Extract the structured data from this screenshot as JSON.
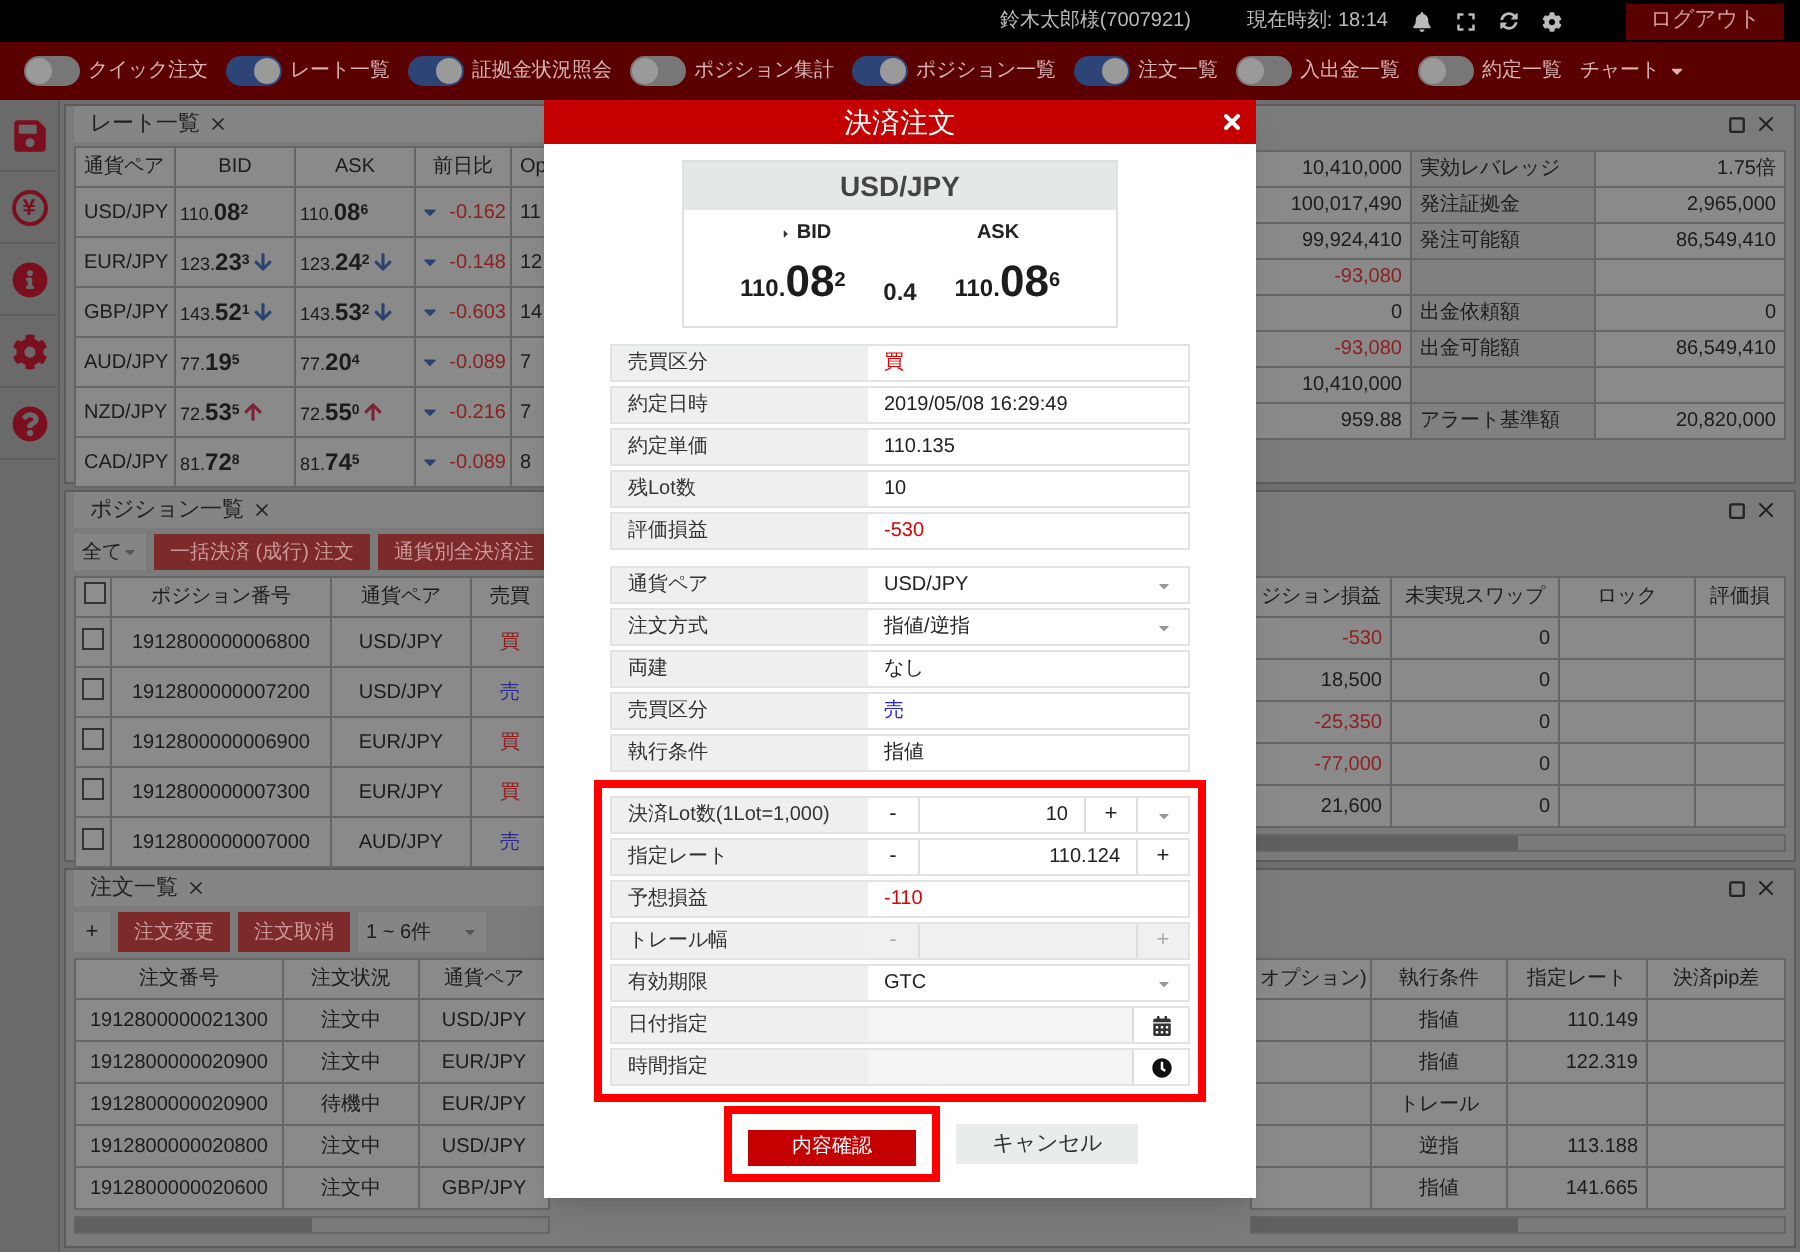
{
  "top_bar": {
    "user": "鈴木太郎様(7007921)",
    "clock": "現在時刻: 18:14",
    "logout": "ログアウト"
  },
  "toolbar": {
    "toggles": [
      {
        "label": "クイック注文",
        "on": false
      },
      {
        "label": "レート一覧",
        "on": true
      },
      {
        "label": "証拠金状況照会",
        "on": true
      },
      {
        "label": "ポジション集計",
        "on": false
      },
      {
        "label": "ポジション一覧",
        "on": true
      },
      {
        "label": "注文一覧",
        "on": true
      },
      {
        "label": "入出金一覧",
        "on": false
      },
      {
        "label": "約定一覧",
        "on": false
      }
    ],
    "menu": "チャート"
  },
  "sidebar": {
    "items": [
      {
        "kind": "save"
      },
      {
        "kind": "yen"
      },
      {
        "kind": "info"
      },
      {
        "kind": "settings"
      },
      {
        "kind": "help"
      }
    ]
  },
  "rate_panel": {
    "tab": "レート一覧",
    "columns": [
      "通貨ペア",
      "BID",
      "ASK",
      "前日比",
      "Op"
    ],
    "rows": [
      {
        "pair": "USD/JPY",
        "bid": {
          "base": "110.",
          "big": "08",
          "pip": "2",
          "falling": false,
          "rising": false
        },
        "ask": {
          "base": "110.",
          "big": "08",
          "pip": "6",
          "falling": false,
          "rising": false
        },
        "change": "-0.162",
        "change_falling": true,
        "column_5": "11"
      },
      {
        "pair": "EUR/JPY",
        "bid": {
          "base": "123.",
          "big": "23",
          "pip": "3",
          "falling": true,
          "rising": false
        },
        "ask": {
          "base": "123.",
          "big": "24",
          "pip": "2",
          "falling": true,
          "rising": false
        },
        "change": "-0.148",
        "change_falling": true,
        "column_5": "12"
      },
      {
        "pair": "GBP/JPY",
        "bid": {
          "base": "143.",
          "big": "52",
          "pip": "1",
          "falling": true,
          "rising": false
        },
        "ask": {
          "base": "143.",
          "big": "53",
          "pip": "2",
          "falling": true,
          "rising": false
        },
        "change": "-0.603",
        "change_falling": true,
        "column_5": "14"
      },
      {
        "pair": "AUD/JPY",
        "bid": {
          "base": "77.",
          "big": "19",
          "pip": "5",
          "falling": false,
          "rising": false
        },
        "ask": {
          "base": "77.",
          "big": "20",
          "pip": "4",
          "falling": false,
          "rising": false
        },
        "change": "-0.089",
        "change_falling": true,
        "column_5": "7"
      },
      {
        "pair": "NZD/JPY",
        "bid": {
          "base": "72.",
          "big": "53",
          "pip": "5",
          "falling": false,
          "rising": true
        },
        "ask": {
          "base": "72.",
          "big": "55",
          "pip": "0",
          "falling": false,
          "rising": true
        },
        "change": "-0.216",
        "change_falling": true,
        "column_5": "7"
      },
      {
        "pair": "CAD/JPY",
        "bid": {
          "base": "81.",
          "big": "72",
          "pip": "8",
          "falling": false,
          "rising": false
        },
        "ask": {
          "base": "81.",
          "big": "74",
          "pip": "5",
          "falling": false,
          "rising": false
        },
        "change": "-0.089",
        "change_falling": true,
        "column_5": "8"
      }
    ]
  },
  "account_panel": {
    "rows": [
      {
        "column_1": "10,410,000",
        "negative": false,
        "label": "実効レバレッジ",
        "value": "1.75倍"
      },
      {
        "column_1": "100,017,490",
        "negative": false,
        "label": "発注証拠金",
        "value": "2,965,000"
      },
      {
        "column_1": "99,924,410",
        "negative": false,
        "label": "発注可能額",
        "value": "86,549,410"
      },
      {
        "column_1": "-93,080",
        "negative": true
      },
      {
        "column_1": "0",
        "negative": false,
        "label": "出金依頼額",
        "value": "0"
      },
      {
        "column_1": "-93,080",
        "negative": true,
        "label": "出金可能額",
        "value": "86,549,410"
      },
      {
        "column_1": "10,410,000",
        "negative": false
      },
      {
        "column_1": "959.88",
        "negative": false,
        "label": "アラート基準額",
        "value": "20,820,000"
      }
    ]
  },
  "positions": {
    "tab": "ポジション一覧",
    "filter": "全て",
    "buttons": [
      "一括決済 (成行) 注文",
      "通貨別全決済注"
    ],
    "all_checked": false,
    "columns": [
      "ポジション番号",
      "通貨ペア",
      "売買"
    ],
    "columns_right": [
      "ジション損益",
      "未実現スワップ",
      "ロック",
      "評価損"
    ],
    "rows": [
      {
        "checked": false,
        "id": "1912800000006800",
        "pair": "USD/JPY",
        "side": "買",
        "buy": true,
        "pl": "-530",
        "negative": true,
        "swap": "0"
      },
      {
        "checked": false,
        "id": "1912800000007200",
        "pair": "USD/JPY",
        "side": "売",
        "buy": false,
        "pl": "18,500",
        "negative": false,
        "swap": "0"
      },
      {
        "checked": false,
        "id": "1912800000006900",
        "pair": "EUR/JPY",
        "side": "買",
        "buy": true,
        "pl": "-25,350",
        "negative": true,
        "swap": "0"
      },
      {
        "checked": false,
        "id": "1912800000007300",
        "pair": "EUR/JPY",
        "side": "買",
        "buy": true,
        "pl": "-77,000",
        "negative": true,
        "swap": "0"
      },
      {
        "checked": false,
        "id": "1912800000007000",
        "pair": "AUD/JPY",
        "side": "売",
        "buy": false,
        "pl": "21,600",
        "negative": false,
        "swap": "0"
      }
    ]
  },
  "orders": {
    "tab": "注文一覧",
    "add": "+",
    "buttons": [
      "注文変更",
      "注文取消"
    ],
    "range": "1 ~ 6件",
    "columns": [
      "注文番号",
      "注文状況",
      "通貨ペア"
    ],
    "columns_right": [
      "オプション)",
      "執行条件",
      "指定レート",
      "決済pip差"
    ],
    "rows": [
      {
        "id": "1912800000021300",
        "status": "注文中",
        "pair": "USD/JPY",
        "condition": "指値",
        "rate": "110.149"
      },
      {
        "id": "1912800000020900",
        "status": "注文中",
        "pair": "EUR/JPY",
        "condition": "指値",
        "rate": "122.319"
      },
      {
        "id": "1912800000020900",
        "status": "待機中",
        "pair": "EUR/JPY",
        "condition": "トレール"
      },
      {
        "id": "1912800000020800",
        "status": "注文中",
        "pair": "USD/JPY",
        "condition": "逆指",
        "rate": "113.188"
      },
      {
        "id": "1912800000020600",
        "status": "注文中",
        "pair": "GBP/JPY",
        "condition": "指値",
        "rate": "141.665"
      }
    ]
  },
  "modal": {
    "title": "決済注文",
    "pair": "USD/JPY",
    "bid_label": "BID",
    "ask_label": "ASK",
    "bid": {
      "base": "110.",
      "big": "08",
      "pip": "2"
    },
    "spread": "0.4",
    "ask": {
      "base": "110.",
      "big": "08",
      "pip": "6"
    },
    "info_rows": [
      {
        "label": "売買区分",
        "value": "買",
        "buy": true
      },
      {
        "label": "約定日時",
        "value": "2019/05/08 16:29:49"
      },
      {
        "label": "約定単価",
        "value": "110.135"
      },
      {
        "label": "残Lot数",
        "value": "10"
      },
      {
        "label": "評価損益",
        "value": "-530",
        "negative": true
      }
    ],
    "order_rows": [
      {
        "label": "通貨ペア",
        "kind": "select",
        "value": "USD/JPY"
      },
      {
        "label": "注文方式",
        "kind": "select",
        "value": "指値/逆指"
      },
      {
        "label": "両建",
        "kind": "text",
        "value": "なし"
      },
      {
        "label": "売買区分",
        "kind": "text",
        "value": "売",
        "buy": false
      },
      {
        "label": "執行条件",
        "kind": "text",
        "value": "指値"
      }
    ],
    "close_rows": {
      "highlighted": true,
      "rows": [
        {
          "label": "決済Lot数(1Lot=1,000)",
          "kind": "stepper_menu",
          "value": "10",
          "minus": "-",
          "plus": "+",
          "disabled": false
        },
        {
          "label": "指定レート",
          "kind": "stepper",
          "value": "110.124",
          "minus": "-",
          "plus": "+",
          "disabled": false
        },
        {
          "label": "予想損益",
          "kind": "text",
          "value": "-110",
          "negative": true,
          "disabled": false
        },
        {
          "label": "トレール幅",
          "kind": "stepper",
          "minus": "-",
          "plus": "+",
          "disabled": true
        },
        {
          "label": "有効期限",
          "kind": "select",
          "value": "GTC",
          "disabled": false
        },
        {
          "label": "日付指定",
          "kind": "date",
          "disabled": false
        },
        {
          "label": "時間指定",
          "kind": "time",
          "disabled": false
        }
      ]
    },
    "confirm": {
      "label": "内容確認",
      "highlighted": true
    },
    "cancel": "キャンセル"
  }
}
